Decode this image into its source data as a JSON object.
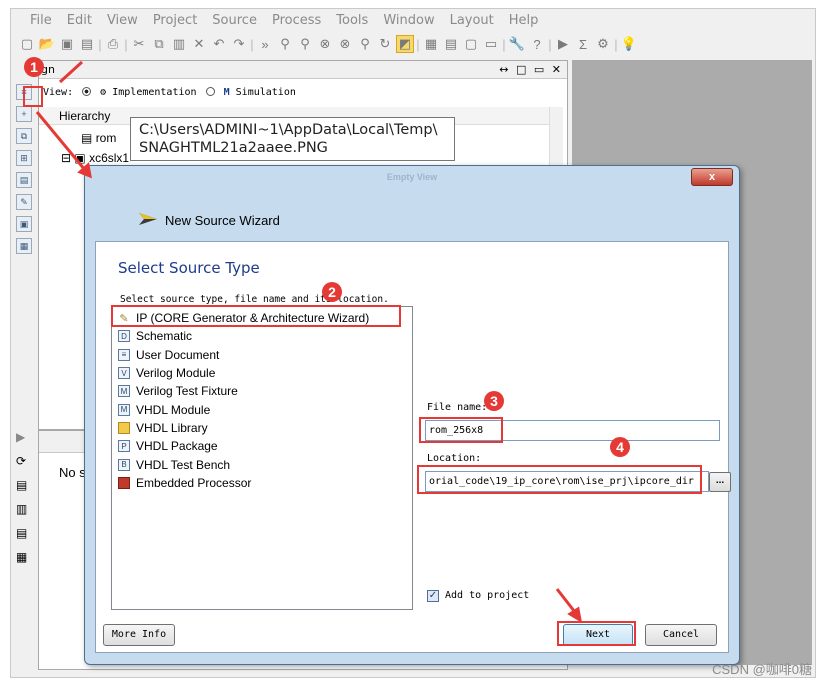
{
  "menu": [
    "File",
    "Edit",
    "View",
    "Project",
    "Source",
    "Process",
    "Tools",
    "Window",
    "Layout",
    "Help"
  ],
  "design_panel": {
    "title": "gn",
    "view_label": "View:",
    "implementation": "Implementation",
    "simulation": "Simulation",
    "hierarchy": "Hierarchy",
    "tree_rom": "rom",
    "tree_device": "xc6slx1",
    "lower_text": "No s"
  },
  "tooltip": {
    "line1": "C:\\Users\\ADMINI~1\\AppData\\Local\\Temp\\",
    "line2": "SNAGHTML21a2aaee.PNG"
  },
  "dialog": {
    "title": "Empty View",
    "wizard_title": "New Source Wizard",
    "close": "x",
    "heading": "Select Source Type",
    "description": "Select source type, file name and its location.",
    "source_types": [
      {
        "label": "IP (CORE Generator & Architecture Wizard)",
        "icon": "ip-core-icon"
      },
      {
        "label": "Schematic",
        "icon": "schematic-icon"
      },
      {
        "label": "User Document",
        "icon": "document-icon"
      },
      {
        "label": "Verilog Module",
        "icon": "verilog-module-icon"
      },
      {
        "label": "Verilog Test Fixture",
        "icon": "verilog-fixture-icon"
      },
      {
        "label": "VHDL Module",
        "icon": "vhdl-module-icon"
      },
      {
        "label": "VHDL Library",
        "icon": "vhdl-library-icon"
      },
      {
        "label": "VHDL Package",
        "icon": "vhdl-package-icon"
      },
      {
        "label": "VHDL Test Bench",
        "icon": "vhdl-testbench-icon"
      },
      {
        "label": "Embedded Processor",
        "icon": "processor-icon"
      }
    ],
    "file_name_label": "File name:",
    "file_name_value": "rom_256x8",
    "location_label": "Location:",
    "location_value": "orial_code\\19_ip_core\\rom\\ise_prj\\ipcore_dir",
    "browse": "...",
    "add_to_project": "Add to project",
    "more_info": "More Info",
    "next": "Next",
    "cancel": "Cancel"
  },
  "badges": [
    "1",
    "2",
    "3",
    "4"
  ],
  "watermark": "CSDN @咖啡0糖",
  "colors": {
    "annotation": "#e53935",
    "heading": "#1e3c8c"
  }
}
